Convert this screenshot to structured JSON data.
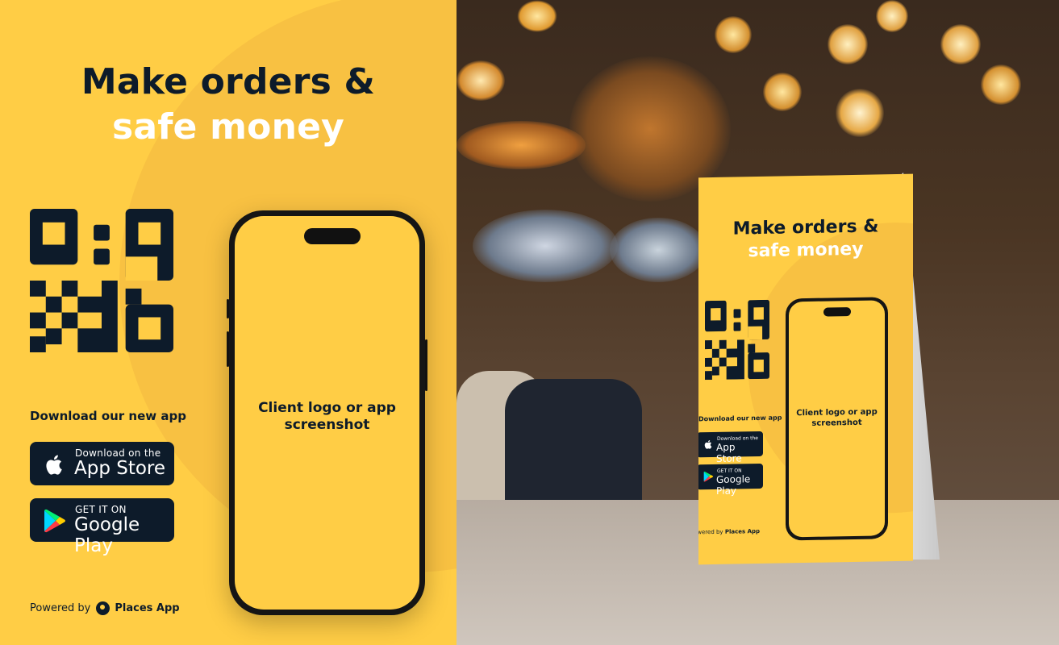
{
  "flyer": {
    "title_line1": "Make orders &",
    "title_line2": "safe money",
    "download_label": "Download our new app",
    "app_store": {
      "small": "Download on the",
      "big": "App Store",
      "icon": "apple-icon"
    },
    "google_play": {
      "small": "GET IT ON",
      "big": "Google Play",
      "icon": "google-play-icon"
    },
    "powered_by": "Powered by",
    "brand": "Places App",
    "phone_placeholder": "Client logo or app screenshot"
  },
  "colors": {
    "accent_yellow": "#FFCD45",
    "arc_yellow": "#F8C142",
    "navy": "#0D1B2A",
    "white": "#FFFFFF"
  },
  "mockup": {
    "title_line1": "Make orders &",
    "title_line2": "safe money",
    "download_label": "Download our new app",
    "app_store_small": "Download on the",
    "app_store_big": "App Store",
    "google_small": "GET IT ON",
    "google_big": "Google Play",
    "powered_by": "Powered by",
    "brand": "Places App",
    "phone_placeholder": "Client logo or app screenshot"
  }
}
